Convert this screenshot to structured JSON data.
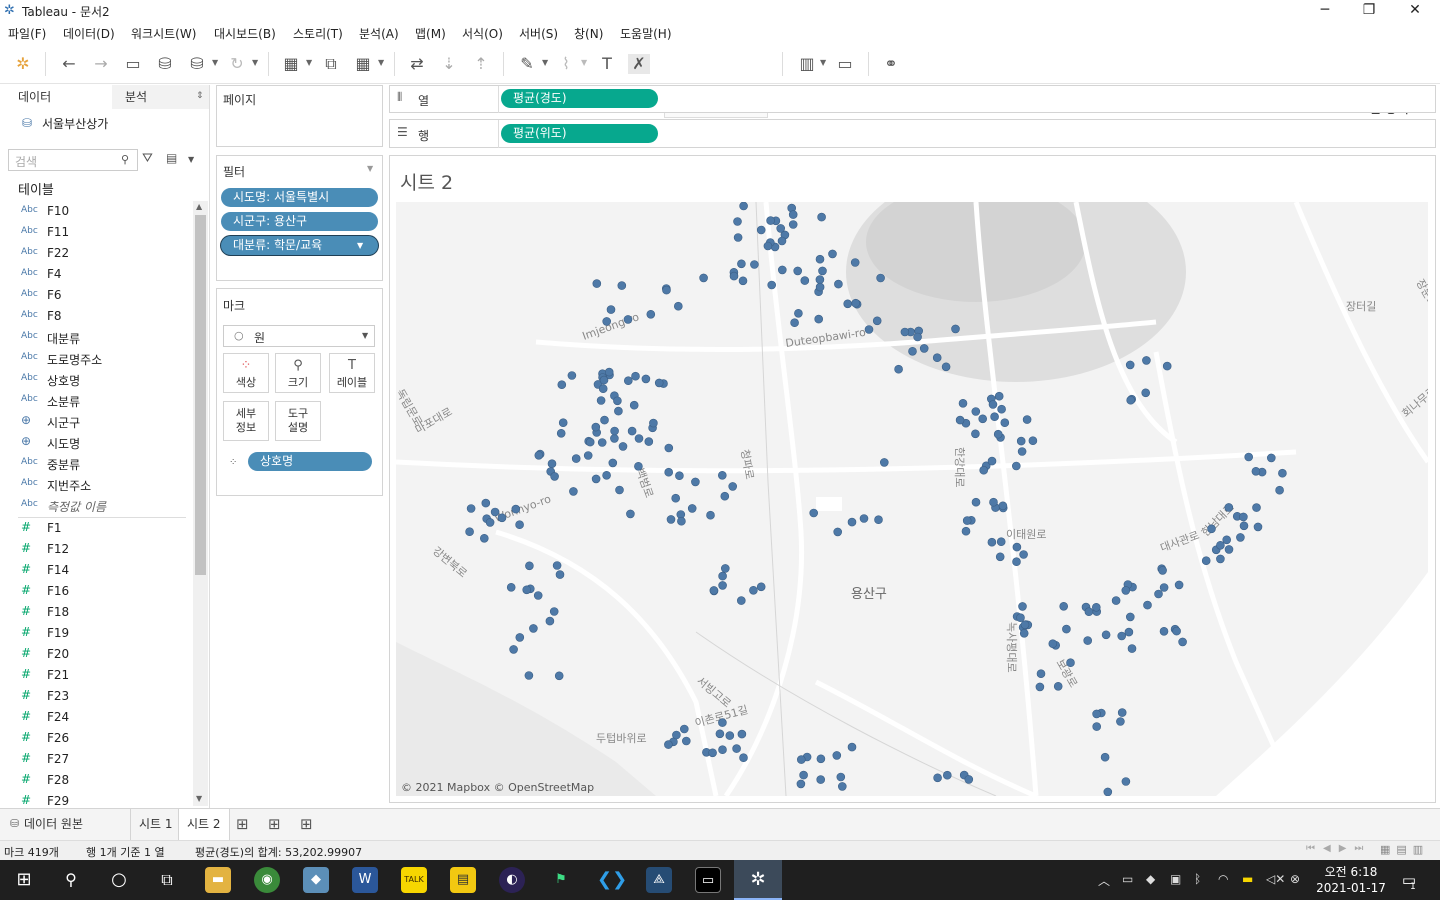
{
  "window": {
    "title": "Tableau - 문서2",
    "minimize": "─",
    "maximize": "❐",
    "close": "✕"
  },
  "menu": [
    "파일(F)",
    "데이터(D)",
    "워크시트(W)",
    "대시보드(B)",
    "스토리(T)",
    "분석(A)",
    "맵(M)",
    "서식(O)",
    "서버(S)",
    "창(N)",
    "도움말(H)"
  ],
  "toolbar": {
    "show_me": "표현 방식"
  },
  "left_pane": {
    "tab_data": "데이터",
    "tab_analysis": "분석",
    "datasource": "서울부산상가",
    "search_placeholder": "검색",
    "tables_heading": "테이블",
    "dimensions": [
      {
        "type": "Abc",
        "name": "F10"
      },
      {
        "type": "Abc",
        "name": "F11"
      },
      {
        "type": "Abc",
        "name": "F22"
      },
      {
        "type": "Abc",
        "name": "F4"
      },
      {
        "type": "Abc",
        "name": "F6"
      },
      {
        "type": "Abc",
        "name": "F8"
      },
      {
        "type": "Abc",
        "name": "대분류"
      },
      {
        "type": "Abc",
        "name": "도로명주소"
      },
      {
        "type": "Abc",
        "name": "상호명"
      },
      {
        "type": "Abc",
        "name": "소분류"
      },
      {
        "type": "geo",
        "name": "시군구"
      },
      {
        "type": "geo",
        "name": "시도명"
      },
      {
        "type": "Abc",
        "name": "중분류"
      },
      {
        "type": "Abc",
        "name": "지번주소"
      },
      {
        "type": "Abc",
        "name": "측정값 이름"
      }
    ],
    "measures": [
      "F1",
      "F12",
      "F14",
      "F16",
      "F18",
      "F19",
      "F20",
      "F21",
      "F23",
      "F24",
      "F26",
      "F27",
      "F28",
      "F29"
    ]
  },
  "pages_card": {
    "title": "페이지"
  },
  "filters_card": {
    "title": "필터",
    "pills": [
      "시도명: 서울특별시",
      "시군구: 용산구",
      "대분류: 학문/교육"
    ]
  },
  "marks_card": {
    "title": "마크",
    "mark_type": "원",
    "buttons": [
      "색상",
      "크기",
      "레이블",
      "세부\n정보",
      "도구\n설명"
    ],
    "detail_pill": "상호명"
  },
  "shelves": {
    "columns_label": "열",
    "columns_pill": "평균(경도)",
    "rows_label": "행",
    "rows_pill": "평균(위도)"
  },
  "view": {
    "sheet_title": "시트 2",
    "attribution": "© 2021 Mapbox © OpenStreetMap",
    "map_labels": [
      "Imjeong-ro",
      "Duteopbawi-ro",
      "용산구",
      "Wonhyo-ro",
      "백범로",
      "청파로",
      "이태원로",
      "대사관로",
      "한강대로",
      "녹사평대로",
      "장터길",
      "독립문로",
      "마포대로",
      "강변북로",
      "서빙고로",
      "이촌로51길",
      "한남대로",
      "두텁바위로",
      "보광로",
      "장문로",
      "회나무로"
    ],
    "point_color": "#4e79a7",
    "marks_count": 419
  },
  "bottom_tabs": {
    "datasource": "데이터 원본",
    "sheets": [
      "시트 1",
      "시트 2"
    ]
  },
  "status": {
    "marks": "마크 419개",
    "rows": "행 1개 기준 1 열",
    "sum": "평균(경도)의 합계: 53,202.99907"
  },
  "taskbar": {
    "time": "오전 6:18",
    "date": "2021-01-17",
    "notifications": "1"
  }
}
